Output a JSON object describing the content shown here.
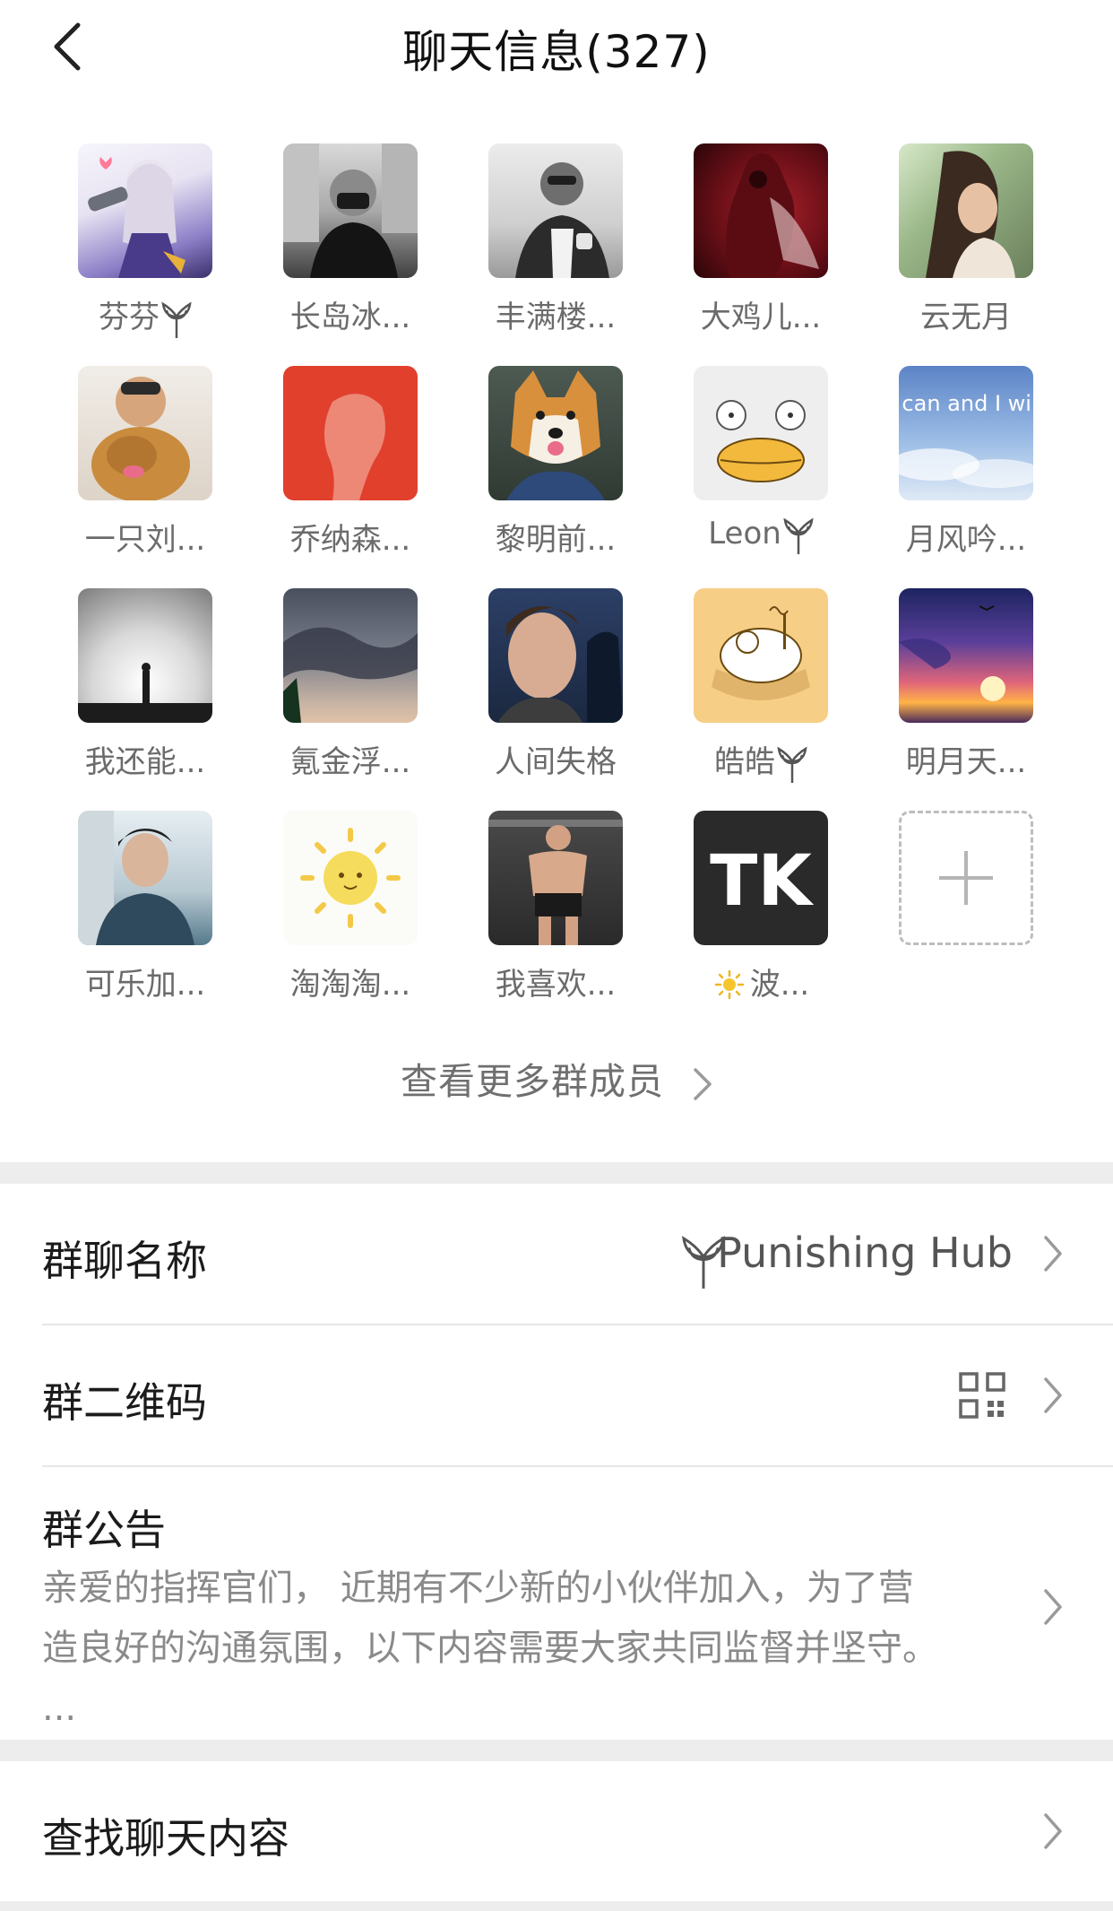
{
  "header": {
    "title": "聊天信息(327)"
  },
  "members": [
    {
      "name": "芬芬",
      "badge": true
    },
    {
      "name": "长岛冰...",
      "badge": false
    },
    {
      "name": "丰满楼...",
      "badge": false
    },
    {
      "name": "大鸡儿...",
      "badge": false
    },
    {
      "name": "云无月",
      "badge": false
    },
    {
      "name": "一只刘...",
      "badge": false
    },
    {
      "name": "乔纳森...",
      "badge": false
    },
    {
      "name": "黎明前...",
      "badge": false
    },
    {
      "name": "Leon",
      "badge": true
    },
    {
      "name": "月风吟...",
      "badge": false
    },
    {
      "name": "我还能...",
      "badge": false
    },
    {
      "name": "氪金浮...",
      "badge": false
    },
    {
      "name": "人间失格",
      "badge": false
    },
    {
      "name": "皓皓",
      "badge": true
    },
    {
      "name": "明月天...",
      "badge": false
    },
    {
      "name": "可乐加...",
      "badge": false
    },
    {
      "name": "淘淘淘...",
      "badge": false
    },
    {
      "name": "我喜欢...",
      "badge": false
    },
    {
      "name": "波...",
      "badge": false,
      "sun_prefix": true
    }
  ],
  "avatar_tiles": {
    "tile_9_text": "I can and I will",
    "tile_18_text": "TK"
  },
  "more_members_label": "查看更多群成员",
  "settings": {
    "group_name_label": "群聊名称",
    "group_name_value": "Punishing Hub",
    "qr_label": "群二维码",
    "notice_label": "群公告",
    "notice_line1": "亲爱的指挥官们， 近期有不少新的小伙伴加入，为了营",
    "notice_line2": "造良好的沟通氛围，以下内容需要大家共同监督并坚守。",
    "notice_line3": "...",
    "search_label": "查找聊天内容"
  },
  "colors": {
    "separator": "#ededed",
    "secondary_text": "#6b6b6b"
  }
}
